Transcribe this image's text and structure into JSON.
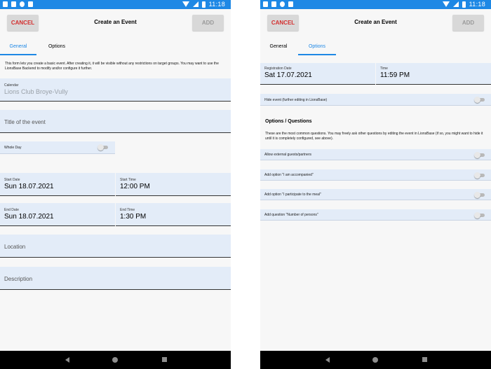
{
  "status_bar": {
    "time": "11:18"
  },
  "screens": [
    {
      "appbar": {
        "cancel_label": "CANCEL",
        "title": "Create an Event",
        "add_label": "ADD"
      },
      "tabs": [
        {
          "label": "General",
          "active": true
        },
        {
          "label": "Options",
          "active": false
        }
      ],
      "info_text": "This form lets you create a basic event. After creating it, it will be visible without any restrictions on target groups. You may want to use the LionsBase Backend to modify and/or configure it further.",
      "calendar": {
        "label": "Calendar",
        "value": "Lions Club Broye-Vully"
      },
      "title_field": {
        "placeholder": "Title of the event"
      },
      "whole_day": {
        "label": "Whole Day",
        "on": false
      },
      "start_date": {
        "label": "Start Date",
        "value": "Sun 18.07.2021"
      },
      "start_time": {
        "label": "Start Time",
        "value": "12:00 PM"
      },
      "end_date": {
        "label": "End Date",
        "value": "Sun 18.07.2021"
      },
      "end_time": {
        "label": "End Time",
        "value": "1:30 PM"
      },
      "location": {
        "placeholder": "Location"
      },
      "description": {
        "placeholder": "Description"
      }
    },
    {
      "appbar": {
        "cancel_label": "CANCEL",
        "title": "Create an Event",
        "add_label": "ADD"
      },
      "tabs": [
        {
          "label": "General",
          "active": false
        },
        {
          "label": "Options",
          "active": true
        }
      ],
      "registration_date": {
        "label": "Registration Date",
        "value": "Sat 17.07.2021"
      },
      "time": {
        "label": "Time",
        "value": "11:59 PM"
      },
      "hide_event": {
        "label": "Hide event (further editing in LionsBase)",
        "on": false
      },
      "section_title": "Options / Questions",
      "section_info": "These are the most common questions. You may freely ask other questions by editing the event in LionsBase (if so, you might want to hide it until it is completely configured, see above).",
      "options": [
        {
          "label": "Allow external guests/partners",
          "on": false
        },
        {
          "label": "Add option \"I am accompanied\"",
          "on": false
        },
        {
          "label": "Add option \"I participate to the meal\"",
          "on": false
        },
        {
          "label": "Add question \"Number of persons\"",
          "on": false
        }
      ]
    }
  ]
}
